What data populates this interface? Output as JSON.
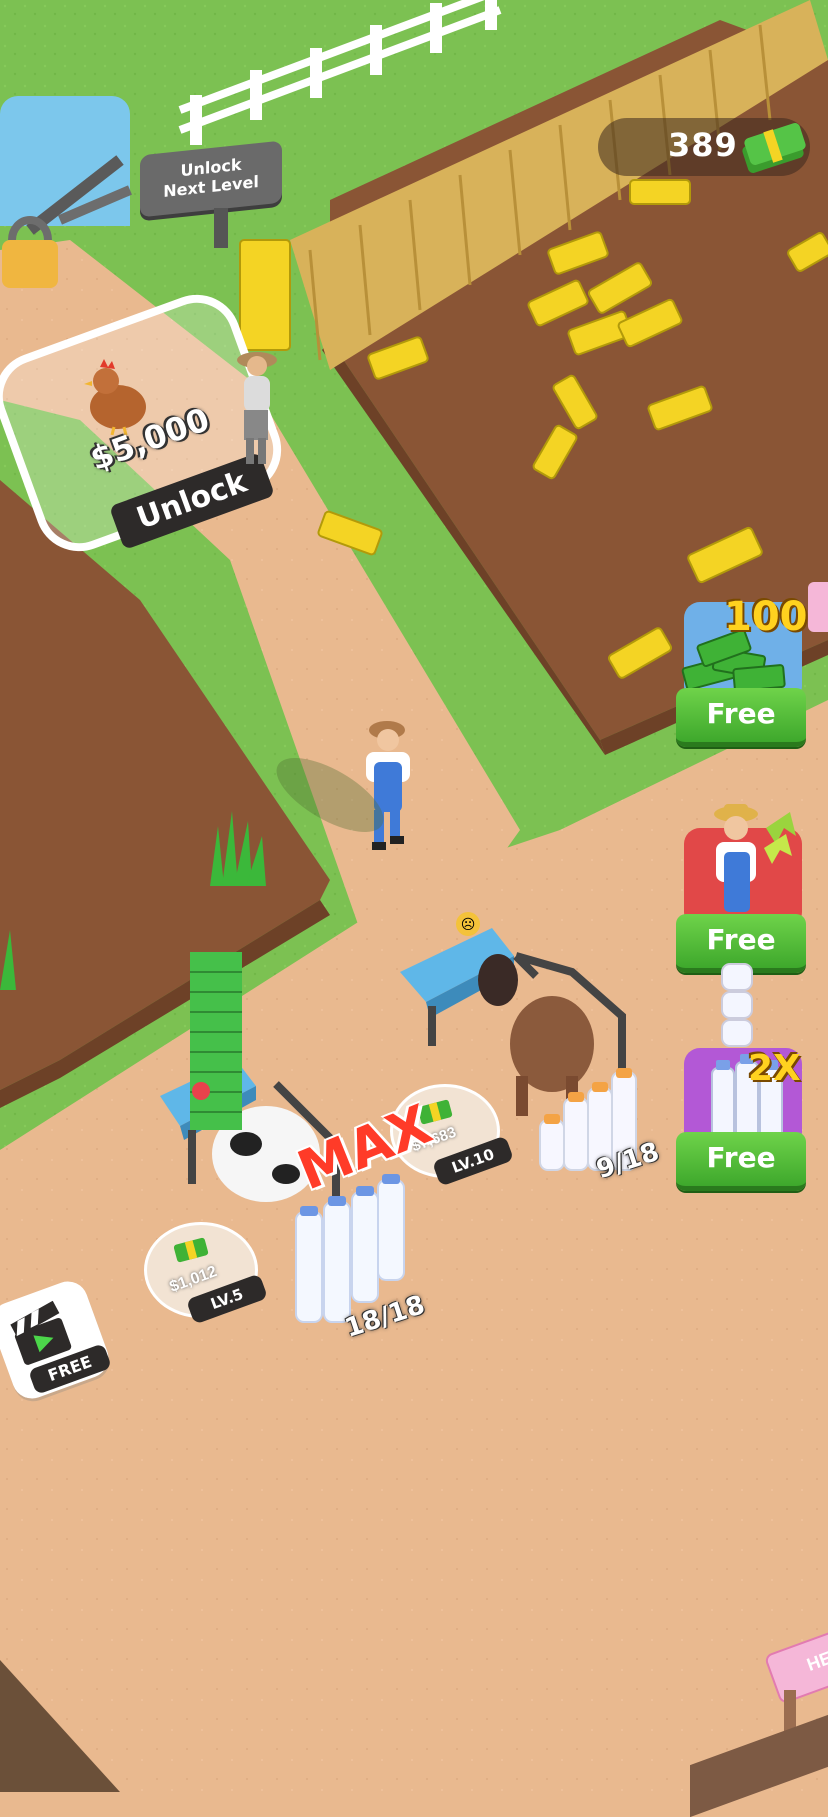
{
  "hud": {
    "money": "389",
    "money_icon": "cash-stack-icon"
  },
  "sign": {
    "line1": "Unlock",
    "line2": "Next Level"
  },
  "unlock_pad": {
    "price": "$5,000",
    "button": "Unlock",
    "animal_icon": "chicken-icon"
  },
  "offers": [
    {
      "badge": "100+",
      "button": "Free",
      "icon": "cash-pile-icon"
    },
    {
      "button": "Free",
      "icon": "farmer-speed-icon"
    },
    {
      "badge": "2X",
      "button": "Free",
      "icon": "milk-bottles-icon"
    }
  ],
  "stations": {
    "cow": {
      "money": "$1,012",
      "level": "LV.5",
      "counter": "18/18",
      "status": "MAX"
    },
    "horse": {
      "money": "$7,683",
      "level": "LV.10",
      "counter": "9/18"
    }
  },
  "ad_button": {
    "label": "FREE",
    "icon": "clapperboard-icon"
  },
  "corner_sign": {
    "text": "HE"
  },
  "colors": {
    "grass": "#7cc152",
    "dirt": "#e9b98f",
    "field": "#8a5535",
    "free_green": "#4cb834",
    "hud_bg": "#3c281e"
  }
}
